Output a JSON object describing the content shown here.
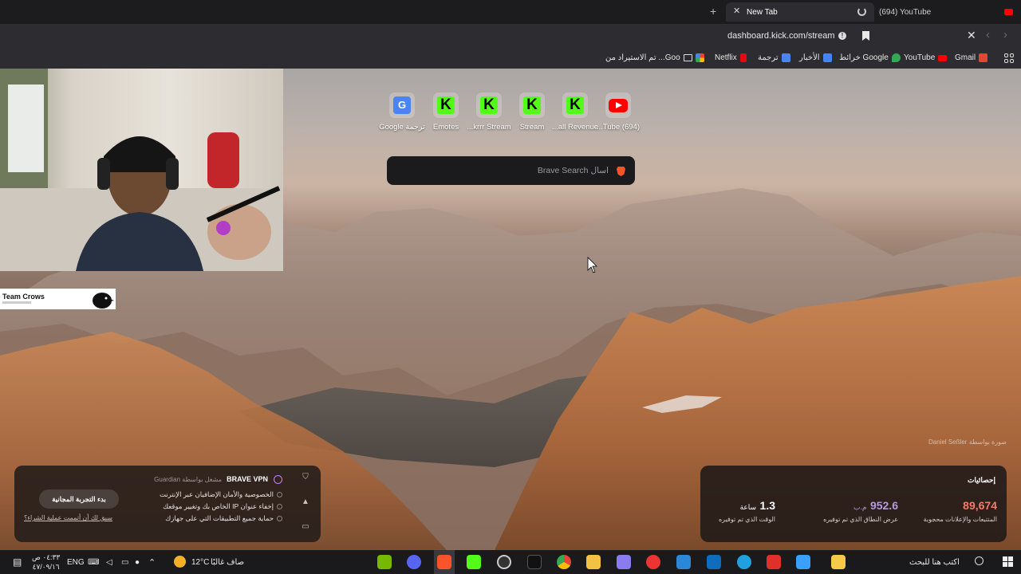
{
  "browser": {
    "tabs": [
      {
        "title": "(694) YouTube",
        "active": false
      },
      {
        "title": "New Tab",
        "active": true,
        "loading": true
      }
    ],
    "url": "dashboard.kick.com/stream",
    "bookmarks": [
      {
        "label": "Gmail",
        "icon": "gmail-icon",
        "color": "#ea4335"
      },
      {
        "label": "YouTube",
        "icon": "youtube-icon",
        "color": "#ff0000"
      },
      {
        "label": "خرائط Google",
        "icon": "maps-icon",
        "color": "#34a853"
      },
      {
        "label": "الأخبار",
        "icon": "news-icon",
        "color": "#4285f4"
      },
      {
        "label": "ترجمة",
        "icon": "translate-icon",
        "color": "#4a84f0"
      },
      {
        "label": "Netflix",
        "icon": "netflix-icon",
        "color": "#e50914"
      },
      {
        "label": "",
        "icon": "photos-icon",
        "color": "#fbbc04"
      },
      {
        "label": "تم الاستيراد من ...Goo",
        "icon": "folder-icon",
        "color": ""
      }
    ]
  },
  "ntp": {
    "tiles": [
      {
        "label": "Google ترجمة",
        "icon": "google-translate-icon"
      },
      {
        "label": "Emotes",
        "icon": "kick-icon"
      },
      {
        "label": "...krrr Stream",
        "icon": "kick-icon"
      },
      {
        "label": "Stream",
        "icon": "kick-icon"
      },
      {
        "label": "...all Revenue",
        "icon": "kick-icon"
      },
      {
        "label": "...Tube (694)",
        "icon": "youtube-icon"
      }
    ],
    "search_placeholder": "اسأل Brave Search",
    "photo_credit": "Daniel Seßler صورة بواسطة",
    "overlay_team": "Team Crows",
    "vpn": {
      "title": "BRAVE VPN",
      "powered_by": "مشغل بواسطة Guardian",
      "features": [
        "الخصوصية والأمان الإضافيان عبر الإنترنت",
        "إخفاء عنوان IP الخاص بك وتغيير موقعك",
        "حماية جميع التطبيقات التي على جهازك"
      ],
      "cta": "بدء التجربة المجانية",
      "link": "سبق لك أن أتممت عملية الشراء؟"
    },
    "stats": {
      "title": "إحصائيات",
      "items": [
        {
          "value": "89,674",
          "unit": "",
          "label": "المتتبعات والإعلانات محجوبة",
          "color": "#f27b6a"
        },
        {
          "value": "952.6",
          "unit": "م.ب",
          "label": "عرض النطاق الذي تم توفيره",
          "color": "#b39ddb"
        },
        {
          "value": "1.3",
          "unit": "ساعة",
          "label": "الوقت الذي تم توفيره",
          "color": "#ffffff"
        }
      ]
    }
  },
  "taskbar": {
    "search_placeholder": "اكتب هنا للبحث",
    "weather_temp": "12°C",
    "weather_text": "صاف غالبًا",
    "language": "ENG",
    "time": "٠٤:٣٣ ص",
    "date": "٤٧/٠٩/١٦",
    "apps": [
      {
        "icon": "copilot-icon",
        "color": "#f7c948"
      },
      {
        "icon": "copilot-app-icon",
        "color": "#3aa0ff"
      },
      {
        "icon": "acrobat-icon",
        "color": "#e0302b"
      },
      {
        "icon": "edge-icon",
        "color": "#1fa1e0"
      },
      {
        "icon": "outlook-icon",
        "color": "#0f6cbd"
      },
      {
        "icon": "app-3-icon",
        "color": "#2b88d8"
      },
      {
        "icon": "media-player-icon",
        "color": "#e33"
      },
      {
        "icon": "game-icon",
        "color": "#8a7cf0"
      },
      {
        "icon": "file-explorer-icon",
        "color": "#f4c242"
      },
      {
        "icon": "chrome-icon",
        "color": "#34a853"
      },
      {
        "icon": "tiktok-icon",
        "color": "#111"
      },
      {
        "icon": "obs-icon",
        "color": "#333"
      },
      {
        "icon": "kick-app-icon",
        "color": "#53fc18"
      },
      {
        "icon": "brave-icon",
        "color": "#fb542b"
      },
      {
        "icon": "discord-icon",
        "color": "#5865f2"
      },
      {
        "icon": "nvidia-icon",
        "color": "#76b900"
      }
    ]
  }
}
